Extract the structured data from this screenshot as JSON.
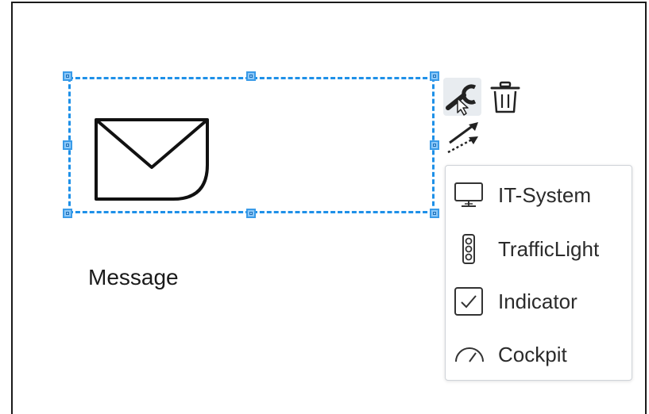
{
  "shape": {
    "label": "Message",
    "icon": "envelope-icon"
  },
  "toolbar": {
    "items": [
      {
        "name": "change-type",
        "icon": "wrench-icon"
      },
      {
        "name": "delete",
        "icon": "trash-icon"
      },
      {
        "name": "connect",
        "icon": "connector-arrow-icon"
      }
    ]
  },
  "menu": {
    "items": [
      {
        "label": "IT-System",
        "icon": "monitor-icon"
      },
      {
        "label": "TrafficLight",
        "icon": "traffic-light-icon"
      },
      {
        "label": "Indicator",
        "icon": "checkbox-icon"
      },
      {
        "label": "Cockpit",
        "icon": "gauge-icon"
      }
    ]
  },
  "colors": {
    "selection": "#1e90e8",
    "handle_fill": "#8cc8f8",
    "frame": "#1a1a1a",
    "text": "#2b2b2b"
  }
}
